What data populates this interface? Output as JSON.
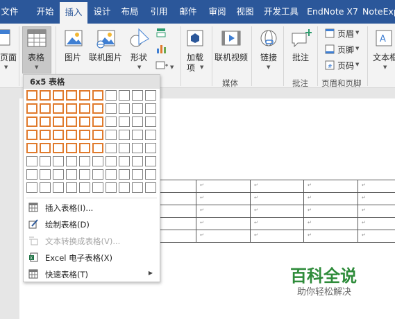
{
  "tabs": [
    "文件",
    "开始",
    "插入",
    "设计",
    "布局",
    "引用",
    "邮件",
    "审阅",
    "视图",
    "开发工具",
    "EndNote X7",
    "NoteExp"
  ],
  "active_tab": "插入",
  "ribbon": {
    "page": "页面",
    "table": "表格",
    "picture": "图片",
    "online_picture": "联机图片",
    "shapes": "形状",
    "addins_line1": "加载",
    "addins_line2": "项",
    "online_video": "联机视频",
    "link": "链接",
    "comment": "批注",
    "header": "页眉",
    "footer": "页脚",
    "page_number": "页码",
    "textbox": "文本框",
    "groups": {
      "media": "媒体",
      "comments": "批注",
      "header_footer": "页眉和页脚"
    }
  },
  "dropdown": {
    "header": "6x5 表格",
    "grid": {
      "cols": 10,
      "rows": 8,
      "selected_cols": 6,
      "selected_rows": 5
    },
    "items": [
      {
        "label": "插入表格(I)...",
        "icon": "table-grid-icon",
        "enabled": true
      },
      {
        "label": "绘制表格(D)",
        "icon": "pencil-table-icon",
        "enabled": true
      },
      {
        "label": "文本转换成表格(V)...",
        "icon": "text-to-table-icon",
        "enabled": false
      },
      {
        "label": "Excel 电子表格(X)",
        "icon": "excel-sheet-icon",
        "enabled": true
      },
      {
        "label": "快速表格(T)",
        "icon": "quick-table-icon",
        "enabled": true,
        "submenu": true
      }
    ]
  },
  "cell_mark": "↵",
  "watermark": {
    "title": "百科全说",
    "subtitle": "助你轻松解决"
  },
  "colors": {
    "accent": "#2b579a",
    "selection": "#e07a2c",
    "watermark": "#2e8b3a"
  }
}
